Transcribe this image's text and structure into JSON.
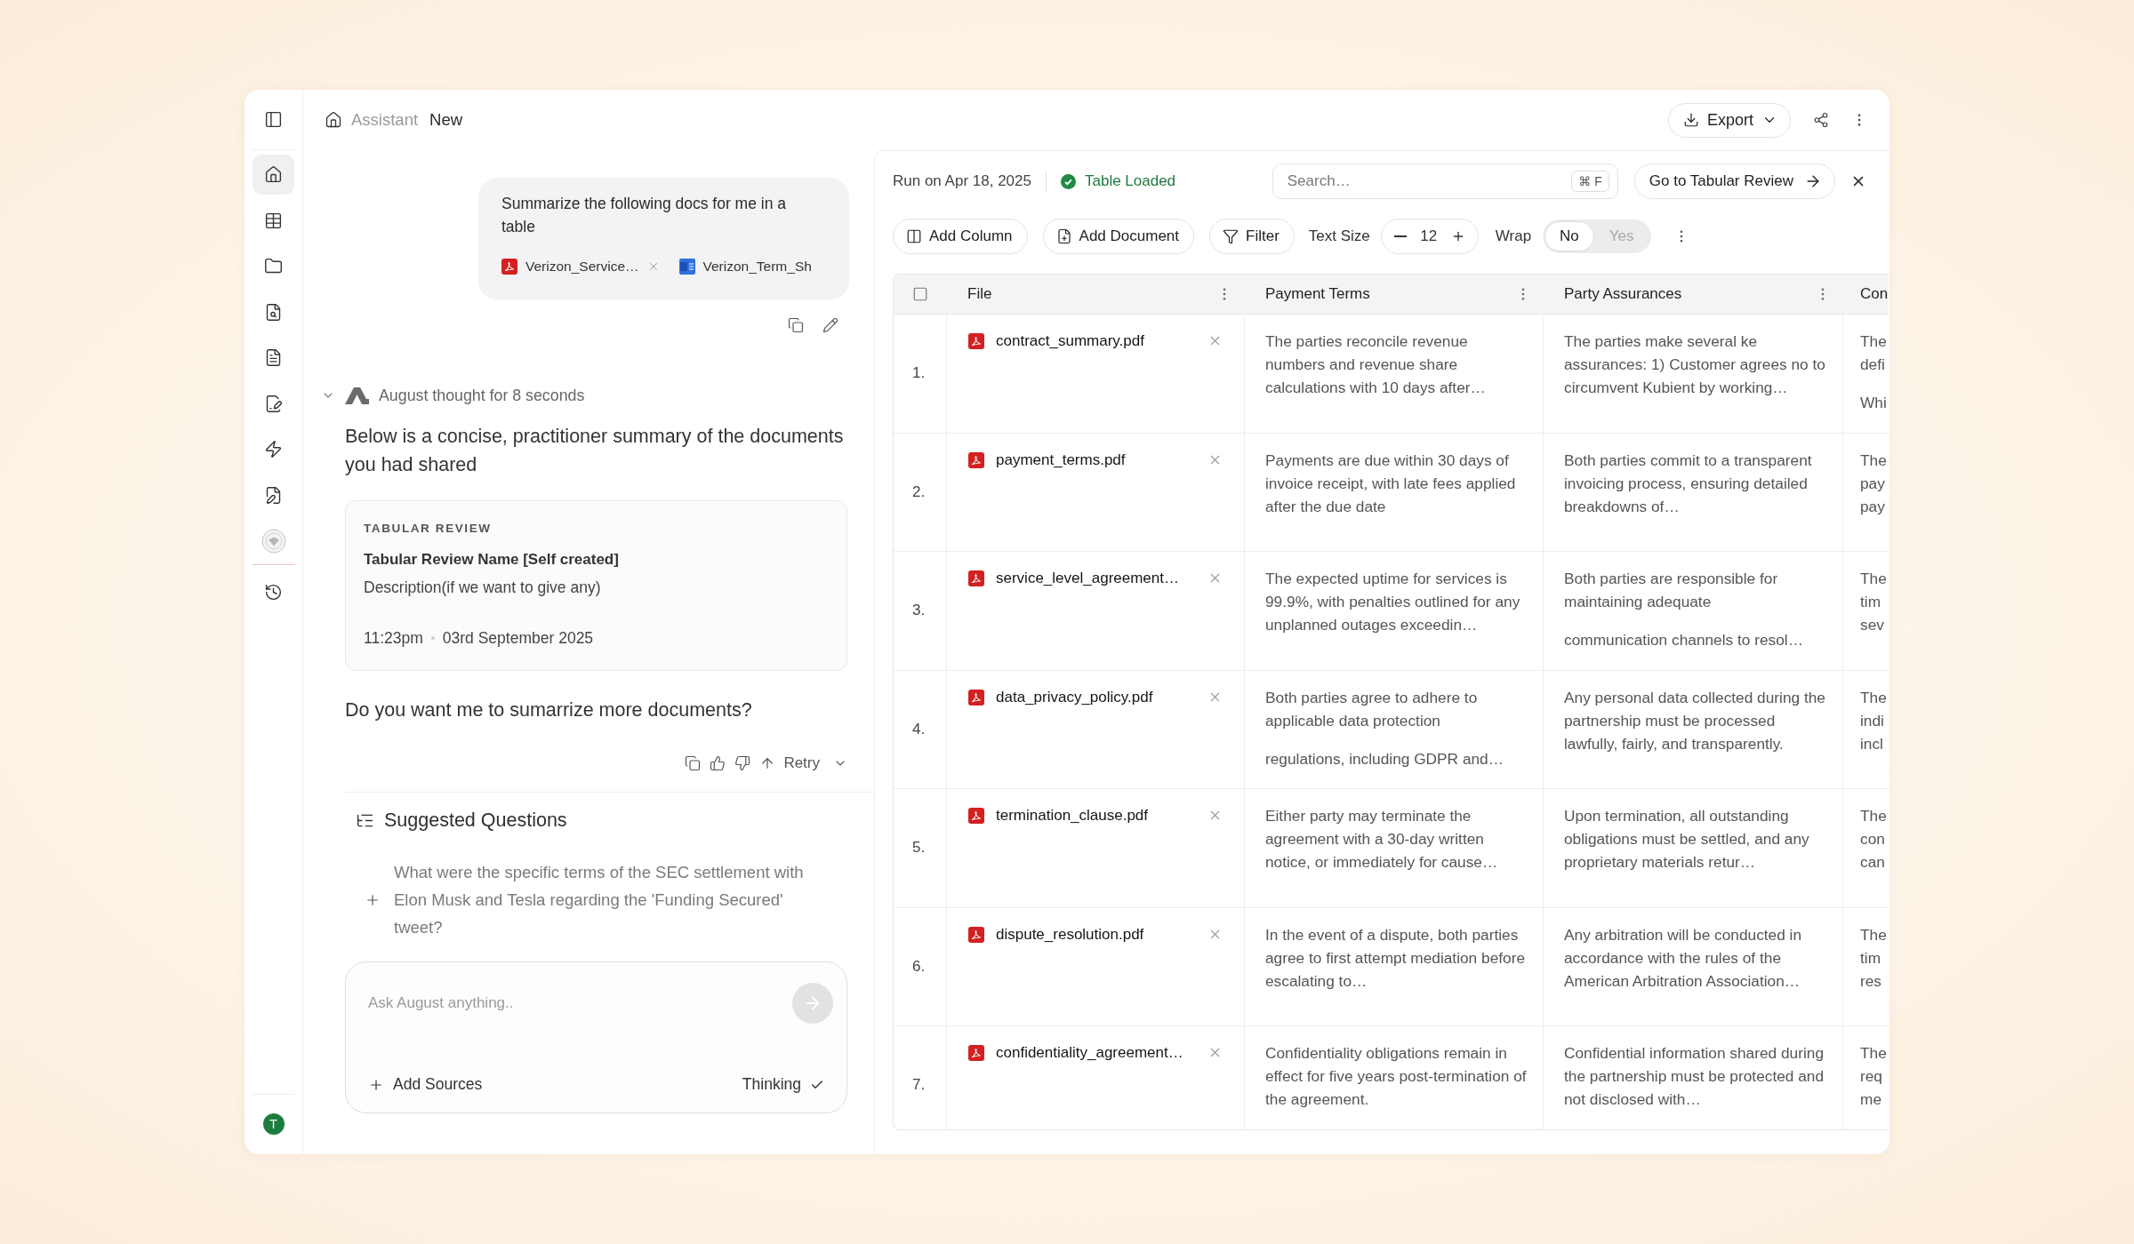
{
  "sidebar": {
    "nav": [
      {
        "selected": true
      },
      {
        "selected": false
      },
      {
        "selected": false
      },
      {
        "selected": false
      },
      {
        "selected": false
      },
      {
        "selected": false
      },
      {
        "selected": false
      },
      {
        "selected": false
      }
    ],
    "history": {
      "selected": false
    },
    "user": {
      "initial": "T"
    }
  },
  "header": {
    "breadcrumb": [
      {
        "label": "Assistant",
        "current": false
      },
      {
        "label": "New",
        "current": true
      }
    ],
    "export_label": "Export"
  },
  "chat": {
    "user_message": {
      "text": "Summarize the following docs for me in a table",
      "attachments": [
        {
          "name": "Verizon_Service…",
          "kind": "pdf",
          "removable": true
        },
        {
          "name": "Verizon_Term_Sh",
          "kind": "doc",
          "removable": false
        }
      ]
    },
    "thought": "August thought for 8 seconds",
    "reply_intro": "Below is a concise, practitioner summary of the documents you had shared",
    "review_card": {
      "eyebrow": "TABULAR REVIEW",
      "title": "Tabular Review Name [Self created]",
      "description": "Description(if we want to give any)",
      "time": "11:23pm",
      "date": "03rd September 2025"
    },
    "follow_up": "Do you want me to sumarrize more documents?",
    "retry_label": "Retry",
    "suggestions": {
      "title": "Suggested Questions",
      "items": [
        "What were the specific terms of the SEC settlement with Elon Musk and Tesla regarding the 'Funding Secured' tweet?"
      ]
    },
    "composer": {
      "placeholder": "Ask August anything..",
      "add_sources_label": "Add Sources",
      "thinking": {
        "label": "Thinking",
        "checked": true
      }
    }
  },
  "table_panel": {
    "run_label": "Run on Apr 18, 2025",
    "status": "Table Loaded",
    "search": {
      "placeholder": "Search…",
      "shortcut": "⌘ F"
    },
    "go_to_label": "Go to Tabular Review",
    "toolbar": {
      "add_column": "Add Column",
      "add_document": "Add Document",
      "filter": "Filter",
      "text_size_label": "Text Size",
      "text_size": "12",
      "wrap_label": "Wrap",
      "wrap_options": [
        {
          "label": "No",
          "selected": true
        },
        {
          "label": "Yes",
          "selected": false
        }
      ]
    },
    "table": {
      "columns": [
        {
          "label": "File",
          "menu": true
        },
        {
          "label": "Payment Terms",
          "menu": true
        },
        {
          "label": "Party Assurances",
          "menu": true
        },
        {
          "label": "Con",
          "menu": false
        }
      ],
      "rows": [
        {
          "number": "1.",
          "cells": [
            {
              "kind": "file",
              "name": "contract_summary.pdf"
            },
            {
              "kind": "text",
              "paragraphs": [
                "The parties reconcile revenue numbers and revenue share calculations with 10 days after…"
              ]
            },
            {
              "kind": "text",
              "paragraphs": [
                "The parties make several ke assurances: 1) Customer agrees no to circumvent Kubient by working…"
              ]
            },
            {
              "kind": "text",
              "paragraphs": [
                "The\ndefi",
                "Whi"
              ]
            }
          ]
        },
        {
          "number": "2.",
          "cells": [
            {
              "kind": "file",
              "name": "payment_terms.pdf"
            },
            {
              "kind": "text",
              "paragraphs": [
                "Payments are due within 30 days of invoice receipt, with late fees applied after the due date"
              ]
            },
            {
              "kind": "text",
              "paragraphs": [
                "Both parties commit to a transparent invoicing process, ensuring detailed breakdowns of…"
              ]
            },
            {
              "kind": "text",
              "paragraphs": [
                "The\npay\npay"
              ]
            }
          ]
        },
        {
          "number": "3.",
          "cells": [
            {
              "kind": "file",
              "name": "service_level_agreement…"
            },
            {
              "kind": "text",
              "paragraphs": [
                "The expected uptime for services is 99.9%, with penalties outlined for any unplanned outages exceedin…"
              ]
            },
            {
              "kind": "text",
              "paragraphs": [
                "Both parties are responsible for maintaining adequate",
                "communication channels to resol…"
              ]
            },
            {
              "kind": "text",
              "paragraphs": [
                "The\ntim\nsev"
              ]
            }
          ]
        },
        {
          "number": "4.",
          "cells": [
            {
              "kind": "file",
              "name": "data_privacy_policy.pdf"
            },
            {
              "kind": "text",
              "paragraphs": [
                "Both parties agree to adhere to applicable data protection",
                "regulations, including GDPR and…"
              ]
            },
            {
              "kind": "text",
              "paragraphs": [
                "Any personal data collected during the partnership must be processed lawfully, fairly, and transparently."
              ]
            },
            {
              "kind": "text",
              "paragraphs": [
                "The\nindi\nincl"
              ]
            }
          ]
        },
        {
          "number": "5.",
          "cells": [
            {
              "kind": "file",
              "name": "termination_clause.pdf"
            },
            {
              "kind": "text",
              "paragraphs": [
                "Either party may terminate the agreement with a 30-day written notice, or immediately for cause…"
              ]
            },
            {
              "kind": "text",
              "paragraphs": [
                "Upon termination, all outstanding obligations must be settled, and any proprietary materials retur…"
              ]
            },
            {
              "kind": "text",
              "paragraphs": [
                "The\ncon\ncan"
              ]
            }
          ]
        },
        {
          "number": "6.",
          "cells": [
            {
              "kind": "file",
              "name": "dispute_resolution.pdf"
            },
            {
              "kind": "text",
              "paragraphs": [
                "In the event of a dispute, both parties agree to first attempt mediation before escalating to…"
              ]
            },
            {
              "kind": "text",
              "paragraphs": [
                "Any arbitration will be conducted in accordance with the rules of the American Arbitration Association…"
              ]
            },
            {
              "kind": "text",
              "paragraphs": [
                "The\ntim\nres"
              ]
            }
          ]
        },
        {
          "number": "7.",
          "cells": [
            {
              "kind": "file",
              "name": "confidentiality_agreement…"
            },
            {
              "kind": "text",
              "paragraphs": [
                "Confidentiality obligations remain in effect for five years post-termination of the agreement."
              ]
            },
            {
              "kind": "text",
              "paragraphs": [
                "Confidential information shared during the partnership must be protected and not disclosed with…"
              ]
            },
            {
              "kind": "text",
              "paragraphs": [
                "The\nreq\nme"
              ]
            }
          ]
        }
      ]
    }
  }
}
